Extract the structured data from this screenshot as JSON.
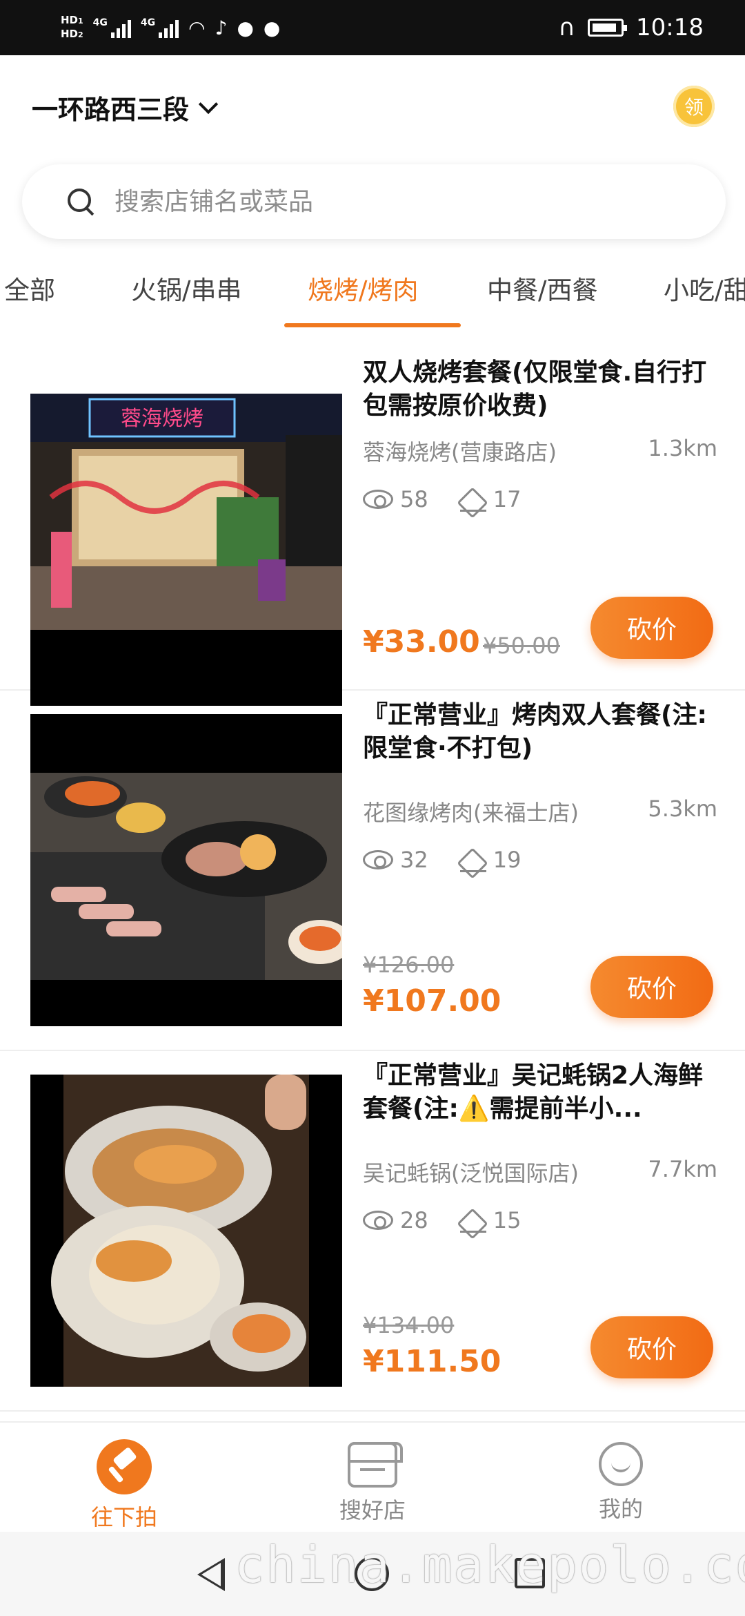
{
  "status_bar": {
    "network_left": "HD",
    "network_sub1": "1",
    "network_sub2": "2",
    "sim_label": "4G",
    "time": "10:18"
  },
  "header": {
    "location": "一环路西三段",
    "coupon_badge": "领"
  },
  "search": {
    "placeholder": "搜索店铺名或菜品"
  },
  "tabs": [
    {
      "label": "全部"
    },
    {
      "label": "火锅/串串"
    },
    {
      "label": "烧烤/烤肉"
    },
    {
      "label": "中餐/西餐"
    },
    {
      "label": "小吃/甜"
    }
  ],
  "active_tab": "烧烤/烤肉",
  "deals": [
    {
      "title": "双人烧烤套餐(仅限堂食.自行打包需按原价收费)",
      "shop": "蓉海烧烤(营康路店)",
      "distance": "1.3km",
      "views": "58",
      "bargains": "17",
      "price": "¥33.00",
      "original_price": "¥50.00",
      "action": "砍价",
      "photo_sign": "蓉海烧烤"
    },
    {
      "title": "『正常营业』烤肉双人套餐(注:限堂食·不打包)",
      "shop": "花图缘烤肉(来福士店)",
      "distance": "5.3km",
      "views": "32",
      "bargains": "19",
      "price": "¥107.00",
      "original_price": "¥126.00",
      "action": "砍价"
    },
    {
      "title": "『正常营业』吴记蚝锅2人海鲜套餐(注:⚠️需提前半小...",
      "shop": "吴记蚝锅(泛悦国际店)",
      "distance": "7.7km",
      "views": "28",
      "bargains": "15",
      "price": "¥111.50",
      "original_price": "¥134.00",
      "action": "砍价"
    }
  ],
  "bottom_nav": [
    {
      "label": "往下拍",
      "icon": "auction-hammer-icon",
      "active": true
    },
    {
      "label": "搜好店",
      "icon": "store-icon",
      "active": false
    },
    {
      "label": "我的",
      "icon": "user-icon",
      "active": false
    }
  ],
  "watermark": "china.makepolo.com",
  "colors": {
    "accent": "#f0781e",
    "coupon": "#f8c33a",
    "status_bar": "#111111"
  }
}
